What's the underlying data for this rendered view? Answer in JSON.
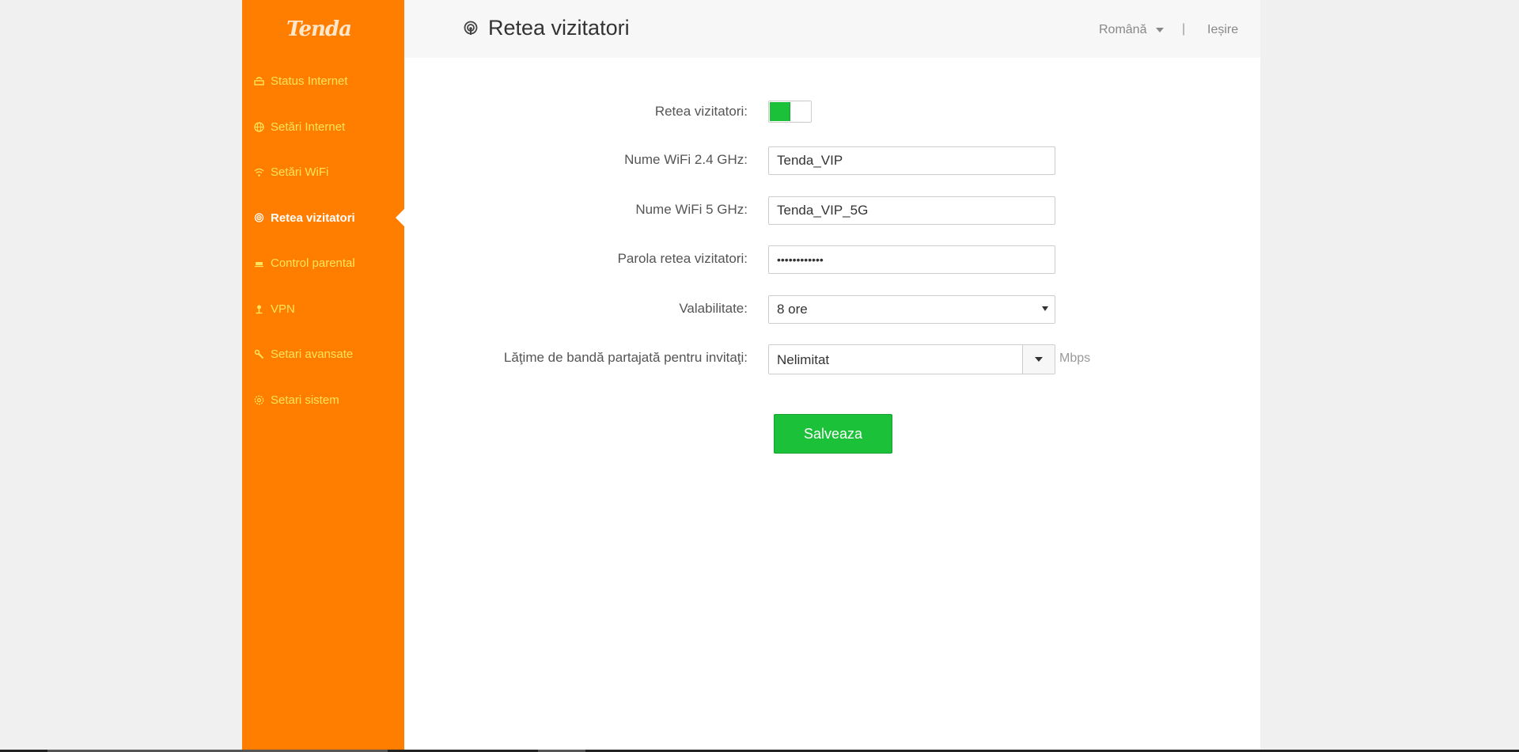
{
  "brand": {
    "logo_text": "Tenda",
    "accent": "#ff7e00",
    "nav_text_color": "#ffe55c",
    "save_color": "#1cc13a"
  },
  "sidebar": {
    "items": [
      {
        "label": "Status Internet",
        "icon": "router-icon"
      },
      {
        "label": "Setări Internet",
        "icon": "globe-icon"
      },
      {
        "label": "Setări WiFi",
        "icon": "wifi-icon"
      },
      {
        "label": "Retea vizitatori",
        "icon": "guest-wifi-icon",
        "active": true
      },
      {
        "label": "Control parental",
        "icon": "parental-icon"
      },
      {
        "label": "VPN",
        "icon": "vpn-icon"
      },
      {
        "label": "Setari avansate",
        "icon": "wrench-icon"
      },
      {
        "label": "Setari sistem",
        "icon": "gear-icon"
      }
    ]
  },
  "header": {
    "title": "Retea vizitatori",
    "language": "Română",
    "separator": "|",
    "logout": "Ieșire"
  },
  "form": {
    "guest_network_label": "Retea vizitatori:",
    "guest_network_enabled": true,
    "wifi24_label": "Nume WiFi 2.4 GHz:",
    "wifi24_value": "Tenda_VIP",
    "wifi5_label": "Nume WiFi 5 GHz:",
    "wifi5_value": "Tenda_VIP_5G",
    "password_label": "Parola retea vizitatori:",
    "password_value": "••••••••••••",
    "validity_label": "Valabilitate:",
    "validity_value": "8 ore",
    "bandwidth_label": "Lăţime de bandă partajată pentru invitaţi:",
    "bandwidth_value": "Nelimitat",
    "bandwidth_unit": "Mbps",
    "save_label": "Salveaza"
  }
}
